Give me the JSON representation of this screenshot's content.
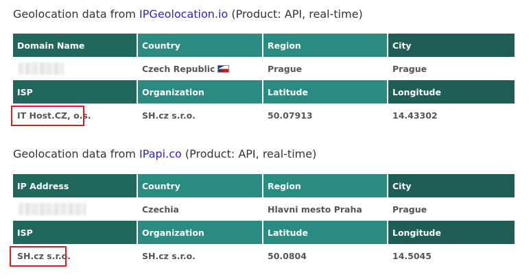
{
  "section1": {
    "title_prefix": "Geolocation data from ",
    "title_link": "IPGeolocation.io",
    "title_suffix": " (Product: API, real-time)",
    "row1_headers": [
      "Domain Name",
      "Country",
      "Region",
      "City"
    ],
    "row1_values": [
      "",
      "Czech Republic",
      "Prague",
      "Prague"
    ],
    "row2_headers": [
      "ISP",
      "Organization",
      "Latitude",
      "Longitude"
    ],
    "row2_values": [
      "IT Host.CZ, o.s.",
      "SH.cz s.r.o.",
      "50.07913",
      "14.43302"
    ],
    "country_flag_icon": "czech-flag-icon"
  },
  "section2": {
    "title_prefix": "Geolocation data from ",
    "title_link": "IPapi.co",
    "title_suffix": " (Product: API, real-time)",
    "row1_headers": [
      "IP Address",
      "Country",
      "Region",
      "City"
    ],
    "row1_values": [
      "",
      "Czechia",
      "Hlavni mesto Praha",
      "Prague"
    ],
    "row2_headers": [
      "ISP",
      "Organization",
      "Latitude",
      "Longitude"
    ],
    "row2_values": [
      "SH.cz s.r.o.",
      "SH.cz s.r.o.",
      "50.0804",
      "14.5045"
    ]
  },
  "colors": {
    "header_dark": "#20685b",
    "header_mid": "#2a8b80",
    "header_darkest": "#1e5e56",
    "link": "#2a1fd6",
    "highlight": "#e0191f"
  }
}
